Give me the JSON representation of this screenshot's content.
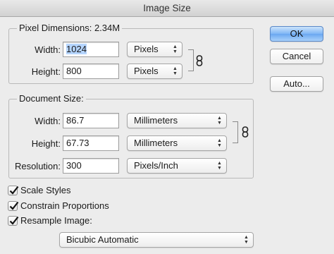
{
  "window": {
    "title": "Image Size"
  },
  "pixel_dimensions": {
    "legend": "Pixel Dimensions:",
    "size": "2.34M",
    "width_label": "Width:",
    "width_value": "1024",
    "width_unit": "Pixels",
    "height_label": "Height:",
    "height_value": "800",
    "height_unit": "Pixels"
  },
  "document_size": {
    "legend": "Document Size:",
    "width_label": "Width:",
    "width_value": "86.7",
    "width_unit": "Millimeters",
    "height_label": "Height:",
    "height_value": "67.73",
    "height_unit": "Millimeters",
    "resolution_label": "Resolution:",
    "resolution_value": "300",
    "resolution_unit": "Pixels/Inch"
  },
  "options": {
    "scale_styles": {
      "label": "Scale Styles",
      "checked": true
    },
    "constrain_proportions": {
      "label": "Constrain Proportions",
      "checked": true
    },
    "resample_image": {
      "label": "Resample Image:",
      "checked": true
    },
    "resample_method": "Bicubic Automatic"
  },
  "buttons": {
    "ok": "OK",
    "cancel": "Cancel",
    "auto": "Auto..."
  },
  "icons": {
    "link": "chain-link-icon",
    "check": "checkmark-icon",
    "arrows": "select-arrows-icon"
  },
  "colors": {
    "default_button": "#6aa7f1",
    "selection": "#b5d5ff",
    "background": "#ececec"
  }
}
